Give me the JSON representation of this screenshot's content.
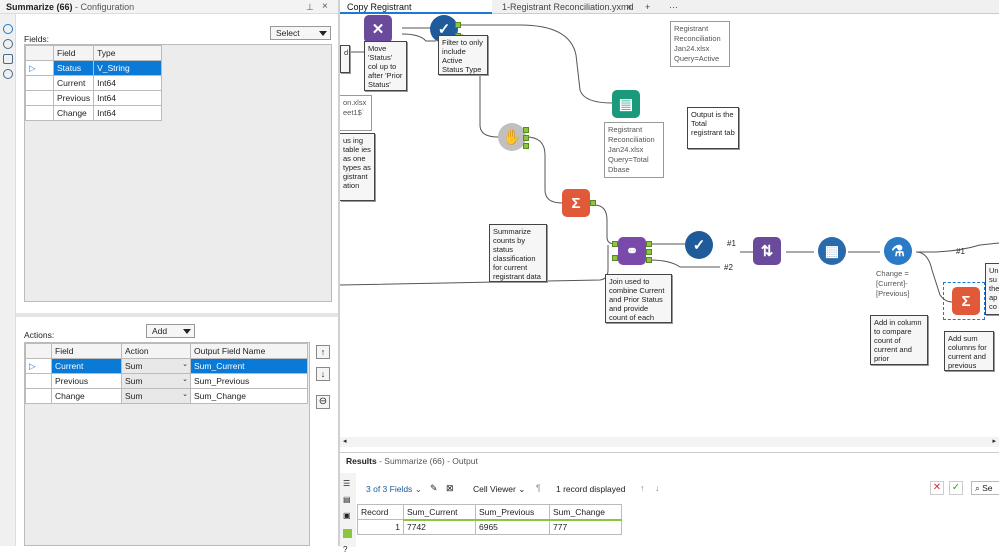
{
  "config": {
    "title": "Summarize (66)",
    "subtitle": "- Configuration",
    "fields_label": "Fields:",
    "select_label": "Select",
    "fields_headers": [
      "Field",
      "Type"
    ],
    "fields": [
      {
        "field": "Status",
        "type": "V_String",
        "selected": true
      },
      {
        "field": "Current",
        "type": "Int64"
      },
      {
        "field": "Previous",
        "type": "Int64"
      },
      {
        "field": "Change",
        "type": "Int64"
      }
    ],
    "actions_label": "Actions:",
    "add_label": "Add",
    "actions_headers": [
      "Field",
      "Action",
      "Output Field Name"
    ],
    "actions": [
      {
        "field": "Current",
        "action": "Sum",
        "output": "Sum_Current",
        "selected": true
      },
      {
        "field": "Previous",
        "action": "Sum",
        "output": "Sum_Previous"
      },
      {
        "field": "Change",
        "action": "Sum",
        "output": "Sum_Change"
      }
    ]
  },
  "tabs": [
    {
      "label": "Copy Registrant Reconciliation.yxmd",
      "active": true
    },
    {
      "label": "1-Registrant Reconciliation.yxmd",
      "active": false
    }
  ],
  "tabs_more": "···",
  "tabs_add": "+",
  "canvas": {
    "annos": {
      "output_active": "Registrant Reconciliation Jan24.xlsx Query=Active",
      "output_total": "Registrant Reconciliation Jan24.xlsx Query=Total Dbase",
      "input_partial": "on.xlsx eet1$`",
      "formula": "Change = [Current]-[Previous]"
    },
    "notes": {
      "move_status": "Move 'Status' col up to after 'Prior Status'",
      "filter_active": "Filter to only include Active Status Type",
      "output_total": "Output is the Total registrant tab",
      "summarize_counts": "Summarize counts by status classification for current registrant data",
      "join_used": "Join used to combine Current and Prior Status and provide count of each",
      "add_column": "Add in column to compare count of current and prior",
      "add_sum": "Add sum columns for current and previous",
      "left_partial": "us ing table ies as one types as gistrant ation",
      "right_partial": "Un su the ap co"
    },
    "labels": {
      "hash1": "#1",
      "hash2": "#2",
      "hash1b": "#1"
    },
    "tool_glyphs": {
      "summarize": "Σ"
    }
  },
  "results": {
    "title": "Results",
    "subtitle": "- Summarize (66) - Output",
    "fields_count": "3 of 3 Fields",
    "cell_viewer": "Cell Viewer",
    "records_displayed": "1 record displayed",
    "search_partial": "Se",
    "headers": [
      "Record",
      "Sum_Current",
      "Sum_Previous",
      "Sum_Change"
    ],
    "rows": [
      [
        "1",
        "7742",
        "6965",
        "777"
      ]
    ]
  }
}
